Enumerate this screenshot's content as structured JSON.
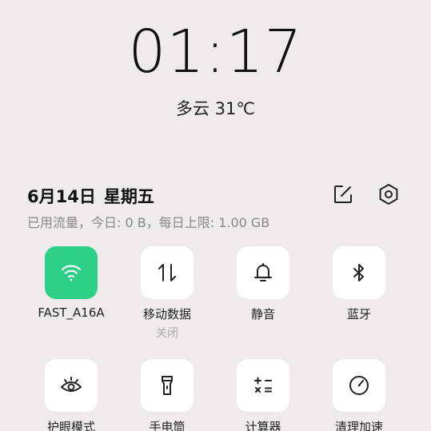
{
  "lockscreen": {
    "time": "01:17",
    "weather": "多云 31℃"
  },
  "header": {
    "date": "6月14日",
    "weekday": "星期五",
    "usage": "已用流量，今日: 0 B，每日上限: 1.00 GB",
    "edit_icon": "edit-icon",
    "settings_icon": "settings-hexagon-icon"
  },
  "tiles": [
    {
      "label": "FAST_A16A",
      "sub": "",
      "icon": "wifi-icon",
      "active": true,
      "accent": "#2ed087"
    },
    {
      "label": "移动数据",
      "sub": "关闭",
      "icon": "mobile-data-icon",
      "active": false
    },
    {
      "label": "静音",
      "sub": "",
      "icon": "bell-icon",
      "active": false
    },
    {
      "label": "蓝牙",
      "sub": "",
      "icon": "bluetooth-icon",
      "active": false
    },
    {
      "label": "护眼模式",
      "sub": "",
      "icon": "eye-icon",
      "active": false
    },
    {
      "label": "手电筒",
      "sub": "",
      "icon": "flashlight-icon",
      "active": false
    },
    {
      "label": "计算器",
      "sub": "",
      "icon": "calculator-icon",
      "active": false
    },
    {
      "label": "清理加速",
      "sub": "",
      "icon": "speedometer-icon",
      "active": false
    }
  ]
}
